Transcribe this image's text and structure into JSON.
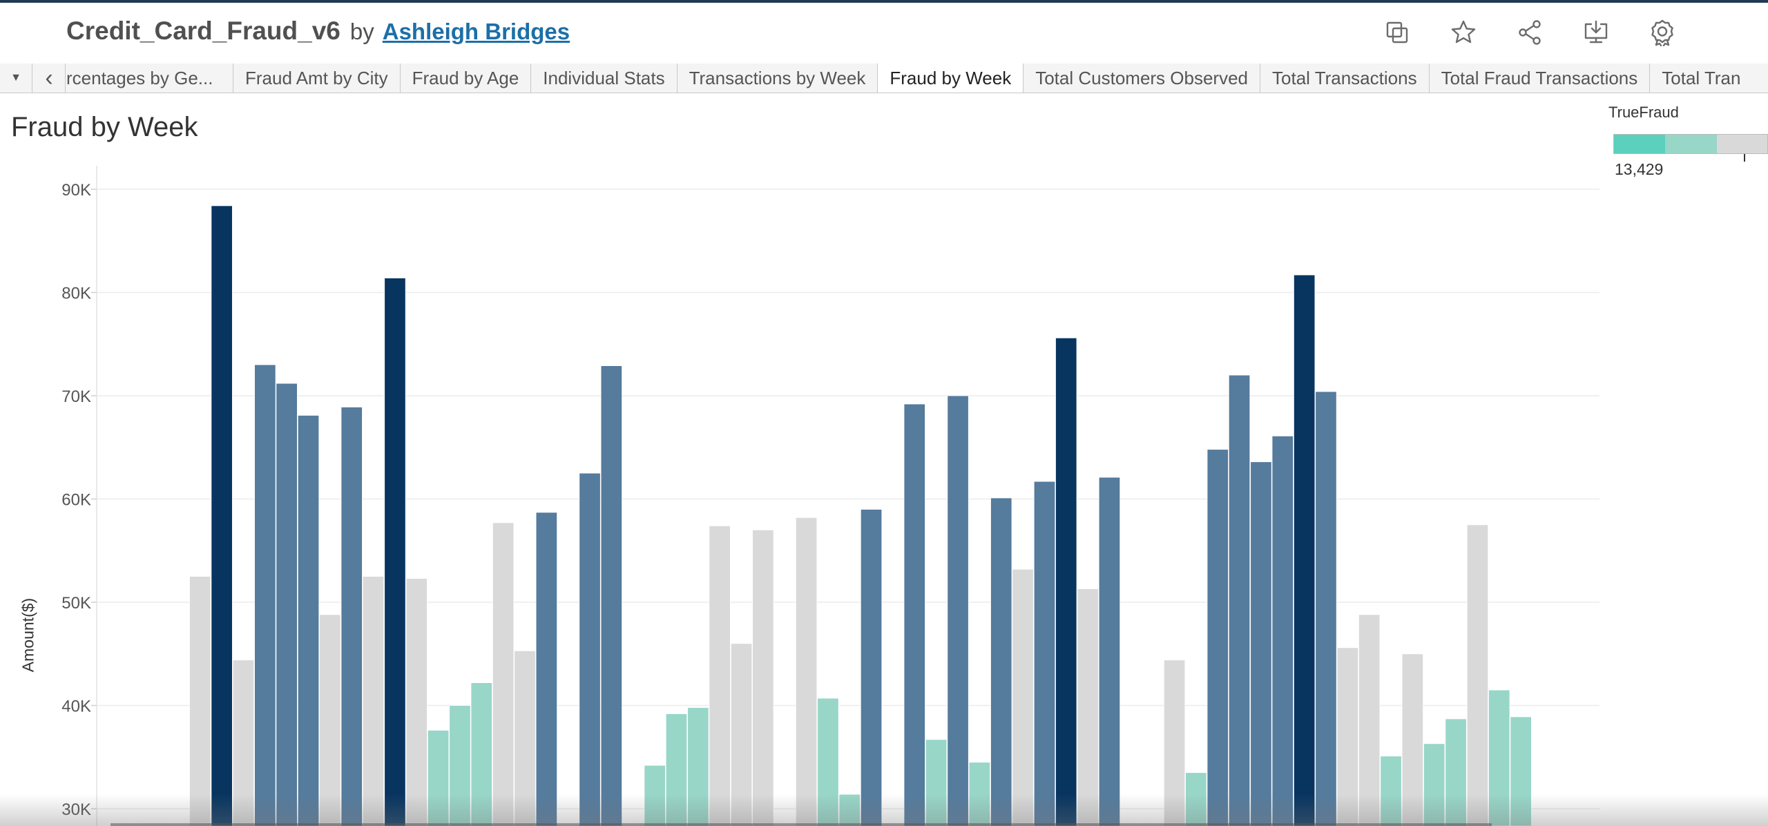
{
  "header": {
    "workbook_title": "Credit_Card_Fraud_v6",
    "by": "by",
    "author": "Ashleigh Bridges",
    "tools": [
      {
        "name": "copy",
        "icon": "copy-icon"
      },
      {
        "name": "favorite",
        "icon": "star-icon"
      },
      {
        "name": "share",
        "icon": "share-icon"
      },
      {
        "name": "download",
        "icon": "download-icon"
      },
      {
        "name": "metadata",
        "icon": "badge-icon"
      }
    ]
  },
  "tabs": {
    "dropdown_glyph": "▼",
    "prev_glyph": "‹",
    "items": [
      "rcentages by Ge...",
      "Fraud Amt by City",
      "Fraud by Age",
      "Individual Stats",
      "Transactions by Week",
      "Fraud by Week",
      "Total Customers Observed",
      "Total Transactions",
      "Total Fraud Transactions",
      "Total Tran"
    ],
    "active": "Fraud by Week"
  },
  "sheet": {
    "title": "Fraud by Week"
  },
  "legend": {
    "title": "TrueFraud",
    "value": "13,429",
    "colors": [
      "#5bd0bc",
      "#98d6c8",
      "#d9d9d9"
    ]
  },
  "colors": {
    "dark_navy": "#083560",
    "steel_blue": "#557b9d",
    "light_teal": "#98d6c8",
    "light_gray": "#d9d9d9"
  },
  "chart_data": {
    "type": "bar",
    "title": "Fraud by Week",
    "ylabel": "Amount($)",
    "ylim": [
      30000,
      90000
    ],
    "yticks": [
      30000,
      40000,
      50000,
      60000,
      70000,
      80000,
      90000
    ],
    "ytick_labels": [
      "30K",
      "40K",
      "50K",
      "60K",
      "70K",
      "80K",
      "90K"
    ],
    "grid": true,
    "values": [
      52500,
      88400,
      44400,
      73000,
      71200,
      68100,
      48800,
      68900,
      52500,
      81400,
      52300,
      37600,
      40000,
      42200,
      57700,
      45300,
      58700,
      null,
      62500,
      72900,
      null,
      34200,
      39200,
      39800,
      57400,
      46000,
      57000,
      null,
      58200,
      40700,
      31400,
      59000,
      null,
      69200,
      36700,
      70000,
      34500,
      60100,
      53200,
      61700,
      75600,
      51300,
      62100,
      null,
      null,
      44400,
      33500,
      64800,
      72000,
      63600,
      66100,
      81700,
      70400,
      45600,
      48800,
      35100,
      45000,
      36300,
      38700,
      57500,
      41500,
      38900
    ],
    "color_groups": [
      "gray",
      "navy",
      "gray",
      "steel",
      "steel",
      "steel",
      "gray",
      "steel",
      "gray",
      "navy",
      "gray",
      "teal",
      "teal",
      "teal",
      "gray",
      "gray",
      "steel",
      null,
      "steel",
      "steel",
      null,
      "teal",
      "teal",
      "teal",
      "gray",
      "gray",
      "gray",
      null,
      "gray",
      "teal",
      "teal",
      "steel",
      null,
      "steel",
      "teal",
      "steel",
      "teal",
      "steel",
      "gray",
      "steel",
      "navy",
      "gray",
      "steel",
      null,
      null,
      "gray",
      "teal",
      "steel",
      "steel",
      "steel",
      "steel",
      "navy",
      "steel",
      "gray",
      "gray",
      "teal",
      "gray",
      "teal",
      "teal",
      "gray",
      "teal",
      "teal"
    ]
  }
}
